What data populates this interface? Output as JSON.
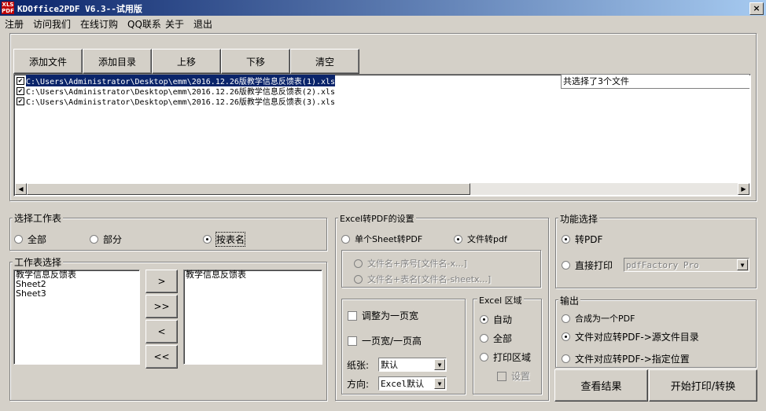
{
  "window": {
    "title": "KDOffice2PDF V6.3--试用版",
    "app_icon": "xls-pdf-icon",
    "close_label": "×"
  },
  "menu": [
    "注册",
    "访问我们",
    "在线订购",
    "QQ联系",
    "关于",
    "退出"
  ],
  "toolbar": [
    "添加文件",
    "添加目录",
    "上移",
    "下移",
    "清空"
  ],
  "files": [
    {
      "checked": true,
      "path": "C:\\Users\\Administrator\\Desktop\\emm\\2016.12.26版教学信息反馈表(1).xls",
      "selected": true
    },
    {
      "checked": true,
      "path": "C:\\Users\\Administrator\\Desktop\\emm\\2016.12.26版教学信息反馈表(2).xls",
      "selected": false
    },
    {
      "checked": true,
      "path": "C:\\Users\\Administrator\\Desktop\\emm\\2016.12.26版教学信息反馈表(3).xls",
      "selected": false
    }
  ],
  "file_count_text": "共选择了3个文件",
  "sheet_select": {
    "label": "选择工作表",
    "options": [
      "全部",
      "部分",
      "按表名"
    ],
    "selected": "按表名"
  },
  "sheet_picker": {
    "label": "工作表选择",
    "available": [
      "教学信息反馈表",
      "Sheet2",
      "Sheet3"
    ],
    "chosen": [
      "教学信息反馈表"
    ],
    "buttons": [
      ">",
      ">>",
      "<",
      "<<"
    ]
  },
  "excel_settings": {
    "label": "Excel转PDF的设置",
    "mode_options": [
      "单个Sheet转PDF",
      "文件转pdf"
    ],
    "mode_selected": "文件转pdf",
    "naming_options": [
      "文件名+序号[文件名-x...]",
      "文件名+表名[文件名-sheetx...]"
    ],
    "fit_width_label": "调整为一页宽",
    "one_page_label": "一页宽/一页高",
    "paper_label": "纸张:",
    "paper_value": "默认",
    "orientation_label": "方向:",
    "orientation_value": "Excel默认",
    "area": {
      "label": "Excel 区域",
      "options": [
        "自动",
        "全部",
        "打印区域"
      ],
      "selected": "自动",
      "settings_label": "设置"
    }
  },
  "function": {
    "label": "功能选择",
    "options": [
      "转PDF",
      "直接打印"
    ],
    "selected": "转PDF",
    "printer_value": "pdfFactory Pro"
  },
  "output": {
    "label": "输出",
    "options": [
      "合成为一个PDF",
      "文件对应转PDF->源文件目录",
      "文件对应转PDF->指定位置"
    ],
    "selected": "文件对应转PDF->源文件目录"
  },
  "actions": {
    "view_result": "查看结果",
    "start": "开始打印/转换"
  }
}
